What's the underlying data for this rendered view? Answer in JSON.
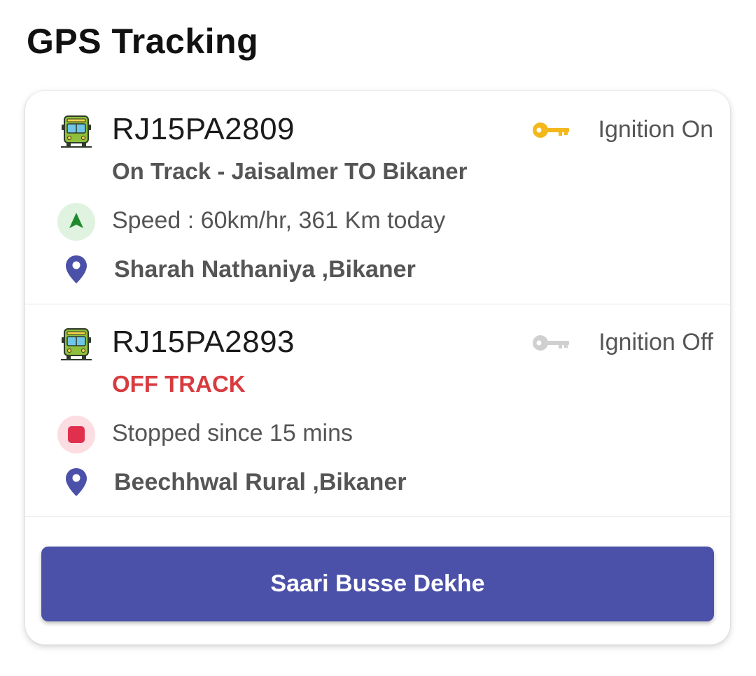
{
  "header": {
    "title": "GPS Tracking"
  },
  "colors": {
    "accent": "#4b51a8",
    "ignition_on": "#f2b81c",
    "ignition_off": "#cccccc",
    "off_track": "#d83b3f",
    "moving": "#1f8a2c",
    "stopped": "#e0304e",
    "pin": "#4b51a8"
  },
  "vehicles": [
    {
      "plate": "RJ15PA2809",
      "ignition": "Ignition On",
      "ignition_icon": "key-icon-on",
      "track_status": "On Track - Jaisalmer TO Bikaner",
      "status_icon": "navigation-arrow-icon",
      "status_text": "Speed : 60km/hr, 361 Km today",
      "location": "Sharah Nathaniya ,Bikaner"
    },
    {
      "plate": "RJ15PA2893",
      "ignition": "Ignition Off",
      "ignition_icon": "key-icon-off",
      "track_status": "OFF TRACK",
      "status_icon": "stop-icon",
      "status_text": "Stopped since 15 mins",
      "location": "Beechhwal Rural ,Bikaner"
    }
  ],
  "footer": {
    "button_label": "Saari Busse Dekhe"
  }
}
